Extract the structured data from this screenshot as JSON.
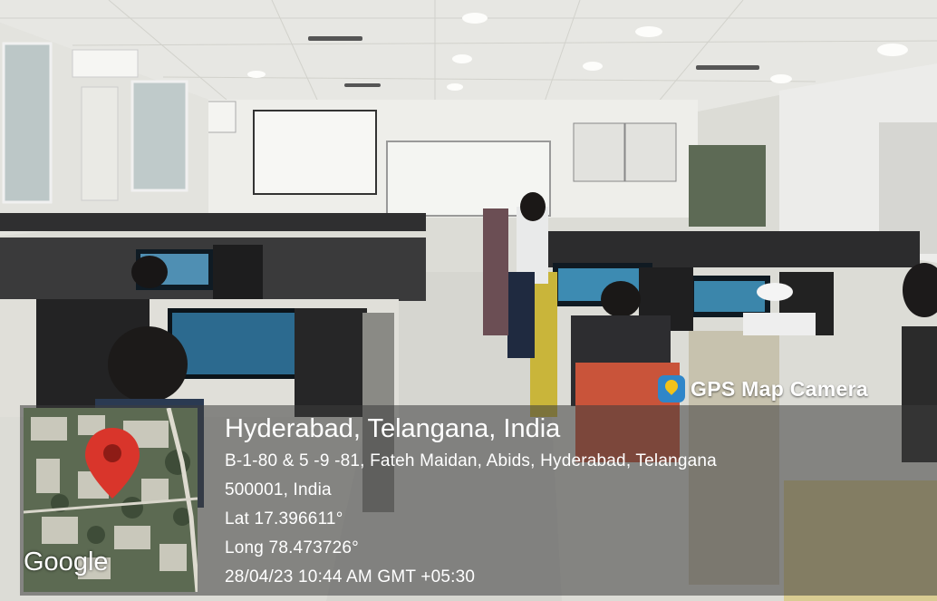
{
  "badge": {
    "label": "GPS Map Camera",
    "icon": "gps-map-camera-icon"
  },
  "location": {
    "city": "Hyderabad, Telangana, India",
    "address_line1": "B-1-80 & 5 -9 -81, Fateh Maidan, Abids, Hyderabad, Telangana",
    "address_line2": "500001, India",
    "lat": "Lat 17.396611°",
    "long": "Long 78.473726°",
    "datetime": "28/04/23 10:44 AM GMT +05:30"
  },
  "map": {
    "brand": "Google",
    "pin_color": "#d9352b"
  }
}
